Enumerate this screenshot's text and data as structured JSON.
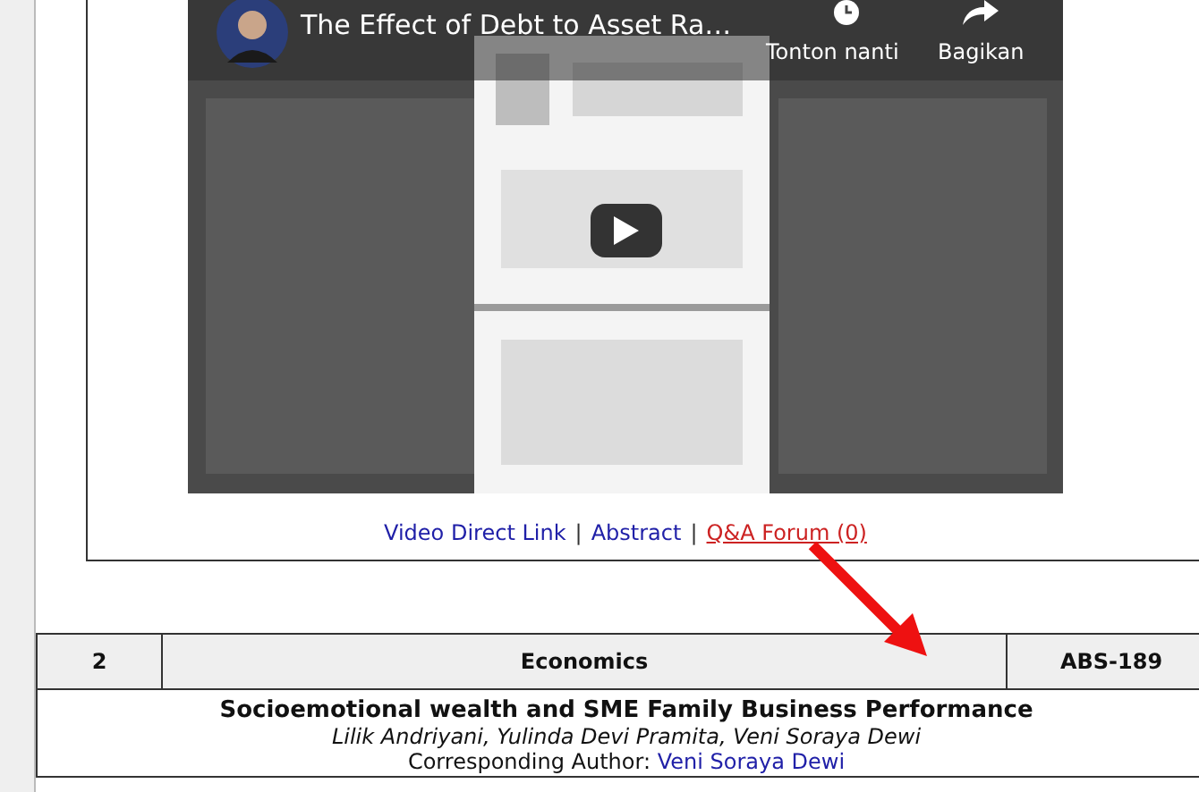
{
  "video": {
    "title": "The Effect of Debt to Asset Ra…",
    "watch_later": "Tonton nanti",
    "share": "Bagikan"
  },
  "links": [
    {
      "label": "Video Direct Link",
      "highlighted": false
    },
    {
      "label": "Abstract",
      "highlighted": false
    },
    {
      "label": "Q&A Forum (0)",
      "highlighted": true
    }
  ],
  "separators": [
    "|",
    "|"
  ],
  "entry": {
    "number": "2",
    "category": "Economics",
    "code": "ABS-189",
    "title": "Socioemotional wealth and SME Family Business Performance",
    "authors": "Lilik Andriyani, Yulinda Devi Pramita, Veni Soraya Dewi",
    "corresponding_label": "Corresponding Author:",
    "corresponding_name": "Veni Soraya Dewi"
  }
}
